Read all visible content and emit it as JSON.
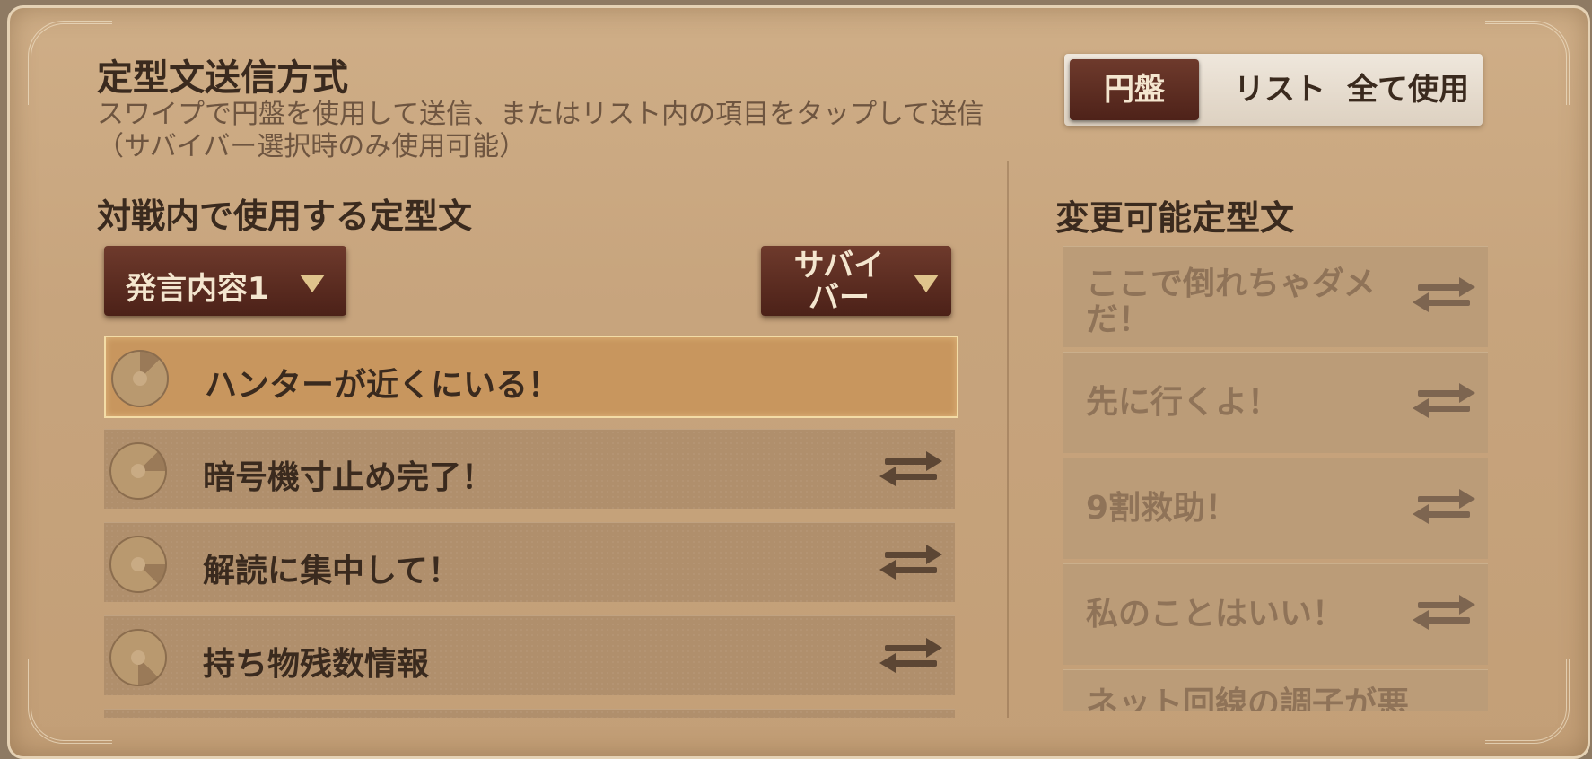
{
  "header": {
    "title": "定型文送信方式",
    "description": "スワイプで円盤を使用して送信、またはリスト内の項目をタップして送信（サバイバー選択時のみ使用可能）"
  },
  "mode_toggle": {
    "options": [
      "円盤",
      "リスト",
      "全て使用"
    ],
    "selected": "円盤"
  },
  "left_section": {
    "title": "対戦内で使用する定型文",
    "dropdown_slot": "発言内容1",
    "dropdown_role": "サバイバー",
    "phrases": [
      {
        "text": "ハンターが近くにいる！",
        "selected": true
      },
      {
        "text": "暗号機寸止め完了！",
        "selected": false
      },
      {
        "text": "解読に集中して！",
        "selected": false
      },
      {
        "text": "持ち物残数情報",
        "selected": false
      }
    ]
  },
  "right_section": {
    "title": "変更可能定型文",
    "phrases": [
      "ここで倒れちゃダメだ！",
      "先に行くよ！",
      "9割救助！",
      "私のことはいい！",
      "ネット回線の調子が悪"
    ]
  },
  "icons": {
    "swap": "swap-arrows-icon",
    "wheel": "wheel-slot-icon",
    "dropdown": "triangle-down-icon"
  },
  "colors": {
    "panel_bg": "#c7a47d",
    "selected_row": "#c8965e",
    "button_dark": "#5a2a20",
    "text_dark": "#3a2a1e"
  }
}
